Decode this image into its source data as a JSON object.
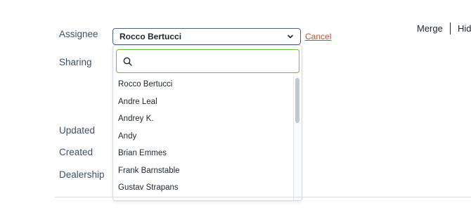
{
  "form": {
    "labels": {
      "assignee": "Assignee",
      "sharing": "Sharing",
      "updated": "Updated",
      "created": "Created",
      "dealership": "Dealership"
    },
    "assignee_select": {
      "value": "Rocco Bertucci",
      "icon": "chevron-down-icon"
    },
    "cancel_label": "Cancel"
  },
  "header_actions": {
    "merge": "Merge",
    "hide": "Hid"
  },
  "dropdown": {
    "search": {
      "placeholder": "",
      "icon": "search-icon",
      "border_color": "#63c33b"
    },
    "options": [
      "Rocco Bertucci",
      "Andre Leal",
      "Andrey K.",
      "Andy",
      "Brian Emmes",
      "Frank Barnstable",
      "Gustav Strapans"
    ]
  },
  "colors": {
    "cancel": "#c0502a",
    "label": "#3b5068"
  }
}
